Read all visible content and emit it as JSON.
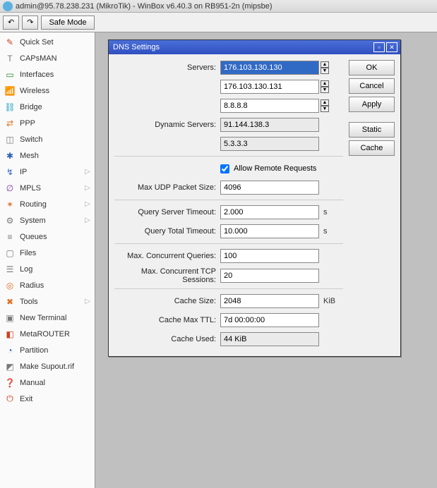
{
  "title": "admin@95.78.238.231 (MikroTik) - WinBox v6.40.3 on RB951-2n (mipsbe)",
  "toolbar": {
    "safe_mode": "Safe Mode"
  },
  "sidebar": {
    "items": [
      {
        "label": "Quick Set",
        "icon": "✎",
        "cls": "ic-red",
        "arrow": false
      },
      {
        "label": "CAPsMAN",
        "icon": "T",
        "cls": "ic-gray",
        "arrow": false
      },
      {
        "label": "Interfaces",
        "icon": "▭",
        "cls": "ic-green",
        "arrow": false
      },
      {
        "label": "Wireless",
        "icon": "📶",
        "cls": "ic-gray",
        "arrow": false
      },
      {
        "label": "Bridge",
        "icon": "⛓",
        "cls": "ic-cyan",
        "arrow": false
      },
      {
        "label": "PPP",
        "icon": "⇄",
        "cls": "ic-orange",
        "arrow": false
      },
      {
        "label": "Switch",
        "icon": "◫",
        "cls": "ic-gray",
        "arrow": false
      },
      {
        "label": "Mesh",
        "icon": "✱",
        "cls": "ic-blue",
        "arrow": false
      },
      {
        "label": "IP",
        "icon": "↯",
        "cls": "ic-blue",
        "arrow": true
      },
      {
        "label": "MPLS",
        "icon": "∅",
        "cls": "ic-purple",
        "arrow": true
      },
      {
        "label": "Routing",
        "icon": "✶",
        "cls": "ic-orange",
        "arrow": true
      },
      {
        "label": "System",
        "icon": "⚙",
        "cls": "ic-gray",
        "arrow": true
      },
      {
        "label": "Queues",
        "icon": "≡",
        "cls": "ic-gray",
        "arrow": false
      },
      {
        "label": "Files",
        "icon": "▢",
        "cls": "ic-gray",
        "arrow": false
      },
      {
        "label": "Log",
        "icon": "☰",
        "cls": "ic-gray",
        "arrow": false
      },
      {
        "label": "Radius",
        "icon": "◎",
        "cls": "ic-orange",
        "arrow": false
      },
      {
        "label": "Tools",
        "icon": "✖",
        "cls": "ic-orange",
        "arrow": true
      },
      {
        "label": "New Terminal",
        "icon": "▣",
        "cls": "ic-gray",
        "arrow": false
      },
      {
        "label": "MetaROUTER",
        "icon": "◧",
        "cls": "ic-red",
        "arrow": false
      },
      {
        "label": "Partition",
        "icon": "◔",
        "cls": "ic-blue",
        "arrow": false
      },
      {
        "label": "Make Supout.rif",
        "icon": "◩",
        "cls": "ic-gray",
        "arrow": false
      },
      {
        "label": "Manual",
        "icon": "❓",
        "cls": "ic-blue",
        "arrow": false
      },
      {
        "label": "Exit",
        "icon": "⏻",
        "cls": "ic-red",
        "arrow": false
      }
    ]
  },
  "dialog": {
    "title": "DNS Settings",
    "servers_label": "Servers:",
    "servers": [
      "176.103.130.130",
      "176.103.130.131",
      "8.8.8.8"
    ],
    "dynamic_label": "Dynamic Servers:",
    "dynamic": [
      "91.144.138.3",
      "5.3.3.3"
    ],
    "allow_remote": "Allow Remote Requests",
    "max_udp_label": "Max UDP Packet Size:",
    "max_udp": "4096",
    "query_server_label": "Query Server Timeout:",
    "query_server": "2.000",
    "query_total_label": "Query Total Timeout:",
    "query_total": "10.000",
    "unit_s": "s",
    "max_conc_q_label": "Max. Concurrent Queries:",
    "max_conc_q": "100",
    "max_conc_tcp_label": "Max. Concurrent TCP Sessions:",
    "max_conc_tcp": "20",
    "cache_size_label": "Cache Size:",
    "cache_size": "2048",
    "unit_kib": "KiB",
    "cache_ttl_label": "Cache Max TTL:",
    "cache_ttl": "7d 00:00:00",
    "cache_used_label": "Cache Used:",
    "cache_used": "44 KiB",
    "buttons": {
      "ok": "OK",
      "cancel": "Cancel",
      "apply": "Apply",
      "static": "Static",
      "cache": "Cache"
    }
  }
}
